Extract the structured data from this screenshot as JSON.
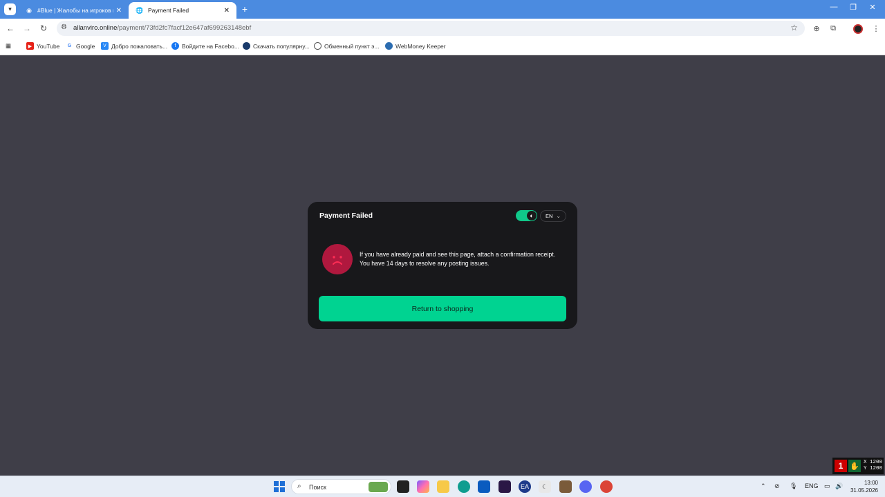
{
  "browser": {
    "tabs": [
      {
        "title": "#Blue | Жалобы на игроков го",
        "active": false
      },
      {
        "title": "Payment Failed",
        "active": true
      }
    ],
    "url_domain": "allanviro.online",
    "url_path": "/payment/73fd2fc7facf12e647af699263148ebf",
    "bookmarks": [
      {
        "label": "YouTube",
        "icon": "youtube-icon",
        "color": "#e62117"
      },
      {
        "label": "Google",
        "icon": "google-icon",
        "color": "#4285f4"
      },
      {
        "label": "Добро пожаловать...",
        "icon": "vk-icon",
        "color": "#2787f5"
      },
      {
        "label": "Войдите на Facebo...",
        "icon": "facebook-icon",
        "color": "#1877f2"
      },
      {
        "label": "Скачать популярну...",
        "icon": "globe-icon",
        "color": "#1a3b6b"
      },
      {
        "label": "Обменный пункт э...",
        "icon": "globe-icon",
        "color": "#555555"
      },
      {
        "label": "WebMoney Keeper",
        "icon": "webmoney-icon",
        "color": "#2b6cb0"
      }
    ]
  },
  "payment": {
    "title": "Payment Failed",
    "language": "EN",
    "message_line1": "If you have already paid and see this page, attach a confirmation receipt.",
    "message_line2": "You have 14 days to resolve any posting issues.",
    "button_label": "Return to shopping"
  },
  "overlay": {
    "x_label": "X 1200",
    "y_label": "Y 1200"
  },
  "taskbar": {
    "search_placeholder": "Поиск",
    "language": "ENG",
    "time": "13:00",
    "date": "31.05.2026"
  },
  "colors": {
    "accent": "#00d391",
    "error": "#b0183e",
    "card_bg": "#18181b",
    "page_bg": "#3f3e48"
  }
}
